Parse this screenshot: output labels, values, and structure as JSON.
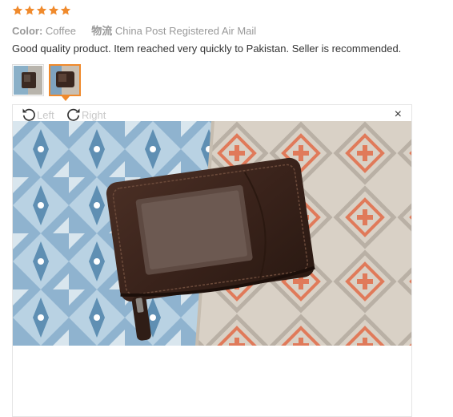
{
  "review": {
    "rating_stars": 5,
    "color_label": "Color:",
    "color_value": "Coffee",
    "shipping_label": "物流",
    "shipping_value": "China Post Registered Air Mail",
    "text": "Good quality product. Item reached very quickly to Pakistan. Seller is recommended.",
    "star_color": "#f08a2c"
  },
  "viewer": {
    "rotate_left_label": "Left",
    "rotate_right_label": "Right",
    "close_label": "×",
    "selected_thumbnail": 2
  },
  "icons": {
    "star": "star-icon",
    "rotate_left": "rotate-left-icon",
    "rotate_right": "rotate-right-icon",
    "close": "close-icon"
  }
}
